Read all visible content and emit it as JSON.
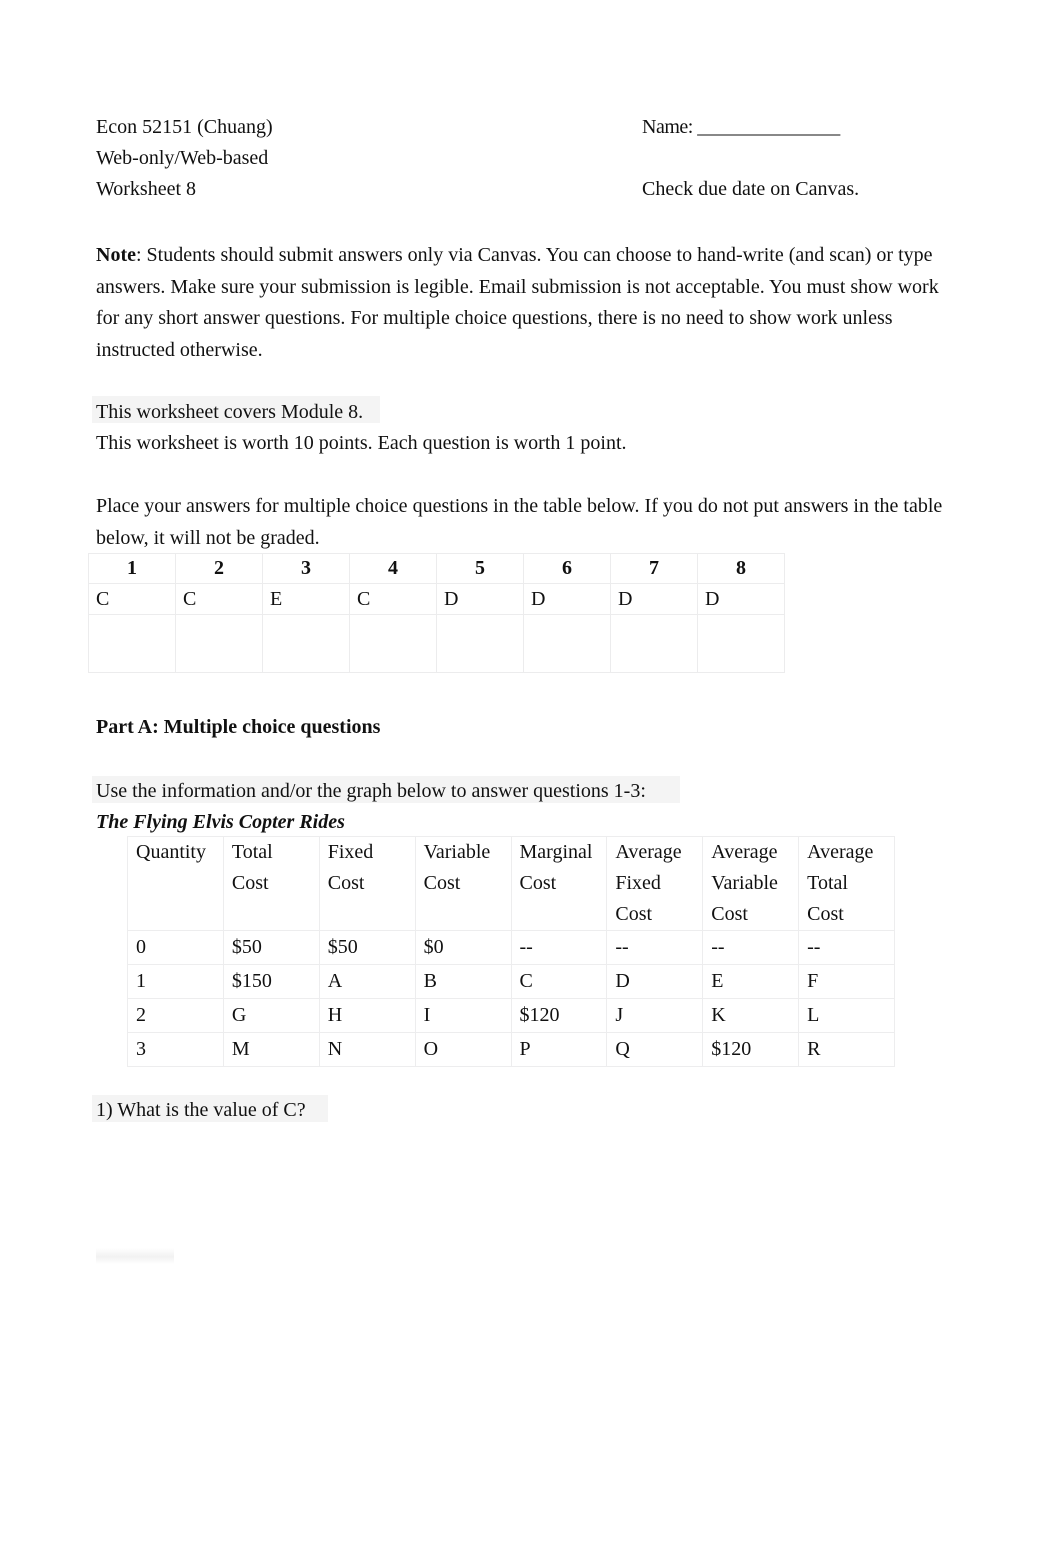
{
  "header": {
    "course": "Econ 52151 (Chuang)",
    "modality": "Web-only/Web-based",
    "worksheet": "Worksheet 8",
    "name_label": "Name: _______________",
    "due_note": "Check due date on Canvas."
  },
  "note": {
    "label": "Note",
    "body": ": Students should submit answers only via Canvas. You can choose to hand-write (and scan) or type answers. Make sure your submission is legible. Email submission is not acceptable. You must show work for any short answer questions. For multiple choice questions, there is no need to show work unless instructed otherwise."
  },
  "scope": {
    "module_line": "This worksheet covers Module 8.",
    "points_line": "This worksheet is worth 10 points. Each question is worth 1 point."
  },
  "instructions": {
    "place_answers": "Place your answers for multiple choice questions in the table below. If you do not put answers in the table below, it will not be graded."
  },
  "answer_table": {
    "numbers": [
      "1",
      "2",
      "3",
      "4",
      "5",
      "6",
      "7",
      "8"
    ],
    "answers": [
      "C",
      "C",
      "E",
      "C",
      "D",
      "D",
      "D",
      "D"
    ]
  },
  "part_a": {
    "heading": "Part A: Multiple choice questions",
    "use_info": "Use the information and/or the graph below to answer questions 1-3:",
    "firm_name": "The Flying Elvis Copter Rides"
  },
  "cost_table": {
    "headers": [
      [
        "Quantity"
      ],
      [
        "Total",
        "Cost"
      ],
      [
        "Fixed",
        "Cost"
      ],
      [
        "Variable",
        "Cost"
      ],
      [
        "Marginal",
        "Cost"
      ],
      [
        "Average",
        "Fixed",
        "Cost"
      ],
      [
        "Average",
        "Variable",
        "Cost"
      ],
      [
        "Average",
        "Total",
        "Cost"
      ]
    ],
    "rows": [
      [
        "0",
        "$50",
        "$50",
        "$0",
        "--",
        "--",
        "--",
        "--"
      ],
      [
        "1",
        "$150",
        "A",
        "B",
        "C",
        "D",
        "E",
        "F"
      ],
      [
        "2",
        "G",
        "H",
        "I",
        "$120",
        "J",
        "K",
        "L"
      ],
      [
        "3",
        "M",
        "N",
        "O",
        "P",
        "Q",
        "$120",
        "R"
      ]
    ]
  },
  "questions": {
    "q1": "1) What is the value of C?"
  },
  "colors": {
    "text": "#111111",
    "page_background": "#ffffff",
    "table_border": "#ededee",
    "scan_tint": "#f4f4f4"
  }
}
